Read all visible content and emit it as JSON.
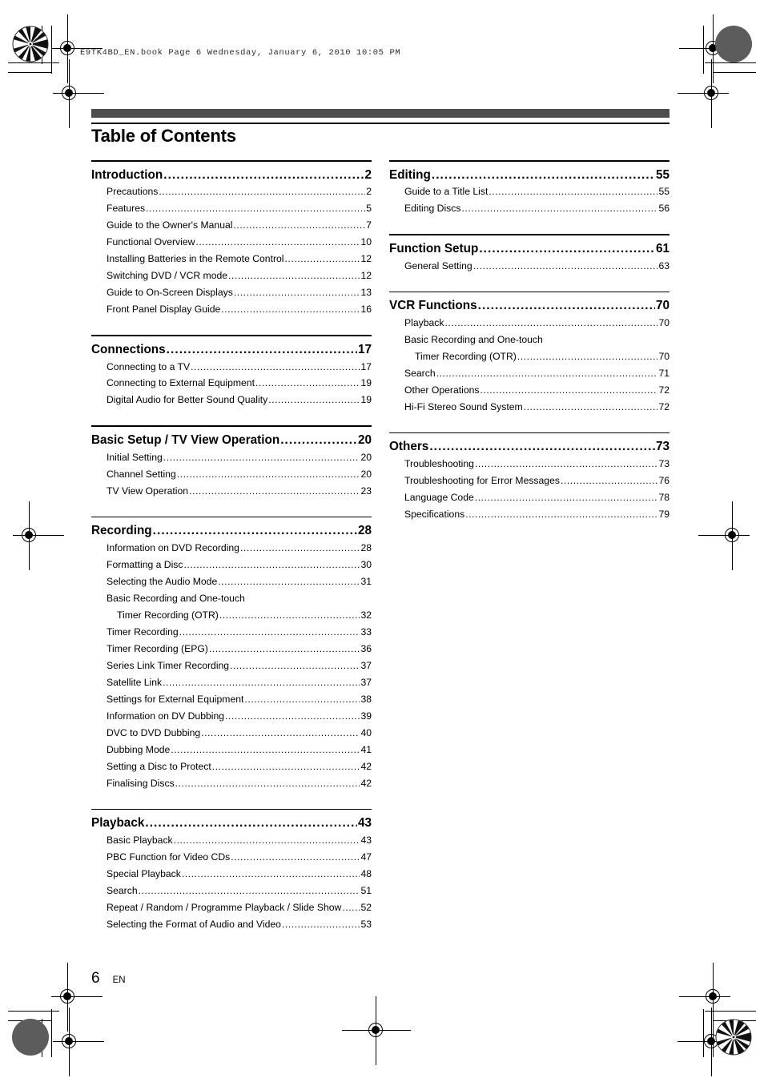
{
  "print_slug": "E9TK4BD_EN.book  Page 6  Wednesday, January 6, 2010  10:05 PM",
  "page_title": "Table of Contents",
  "footer": {
    "page_number": "6",
    "language_code": "EN"
  },
  "leader_dots": "..................................................................................................................",
  "columns": [
    {
      "name": "left-column",
      "sections": [
        {
          "heading": "Introduction",
          "page": "2",
          "entries": [
            {
              "label": "Precautions",
              "page": "2"
            },
            {
              "label": "Features",
              "page": "5"
            },
            {
              "label": "Guide to the Owner's Manual",
              "page": "7"
            },
            {
              "label": "Functional Overview",
              "page": "10"
            },
            {
              "label": "Installing Batteries in the Remote Control",
              "page": "12"
            },
            {
              "label": "Switching DVD / VCR mode",
              "page": "12"
            },
            {
              "label": "Guide to On-Screen Displays",
              "page": "13"
            },
            {
              "label": "Front Panel Display Guide",
              "page": "16"
            }
          ]
        },
        {
          "heading": "Connections",
          "page": "17",
          "entries": [
            {
              "label": "Connecting to a TV",
              "page": "17"
            },
            {
              "label": "Connecting to External Equipment",
              "page": "19"
            },
            {
              "label": "Digital Audio for Better Sound Quality",
              "page": "19"
            }
          ]
        },
        {
          "heading": "Basic Setup / TV View Operation",
          "page": "20",
          "entries": [
            {
              "label": "Initial Setting",
              "page": "20"
            },
            {
              "label": "Channel Setting",
              "page": "20"
            },
            {
              "label": "TV View Operation",
              "page": "23"
            }
          ]
        },
        {
          "heading": "Recording",
          "page": "28",
          "entries": [
            {
              "label": "Information on DVD Recording",
              "page": "28"
            },
            {
              "label": "Formatting a Disc",
              "page": "30"
            },
            {
              "label": "Selecting the Audio Mode",
              "page": "31"
            },
            {
              "label": "Basic Recording and One-touch",
              "label2": "Timer Recording (OTR)",
              "page": "32"
            },
            {
              "label": "Timer Recording",
              "page": "33"
            },
            {
              "label": "Timer Recording (EPG)",
              "page": "36"
            },
            {
              "label": "Series Link Timer Recording",
              "page": "37"
            },
            {
              "label": "Satellite Link",
              "page": "37"
            },
            {
              "label": "Settings for External Equipment",
              "page": "38"
            },
            {
              "label": "Information on DV Dubbing",
              "page": "39"
            },
            {
              "label": "DVC to DVD Dubbing",
              "page": "40"
            },
            {
              "label": "Dubbing Mode",
              "page": "41"
            },
            {
              "label": "Setting a Disc to Protect",
              "page": "42"
            },
            {
              "label": "Finalising Discs",
              "page": "42"
            }
          ]
        },
        {
          "heading": "Playback",
          "page": "43",
          "entries": [
            {
              "label": "Basic Playback",
              "page": "43"
            },
            {
              "label": "PBC Function for Video CDs",
              "page": "47"
            },
            {
              "label": "Special Playback",
              "page": "48"
            },
            {
              "label": "Search",
              "page": "51"
            },
            {
              "label": "Repeat / Random / Programme Playback / Slide Show",
              "page": "52"
            },
            {
              "label": "Selecting the Format of Audio and Video",
              "page": "53"
            }
          ]
        }
      ]
    },
    {
      "name": "right-column",
      "sections": [
        {
          "heading": "Editing",
          "page": "55",
          "entries": [
            {
              "label": "Guide to a Title List",
              "page": "55"
            },
            {
              "label": "Editing Discs",
              "page": "56"
            }
          ]
        },
        {
          "heading": "Function Setup",
          "page": "61",
          "entries": [
            {
              "label": "General Setting",
              "page": "63"
            }
          ]
        },
        {
          "heading": "VCR Functions",
          "page": "70",
          "entries": [
            {
              "label": "Playback",
              "page": "70"
            },
            {
              "label": "Basic Recording and One-touch",
              "label2": "Timer Recording (OTR)",
              "page": "70"
            },
            {
              "label": "Search",
              "page": "71"
            },
            {
              "label": "Other Operations",
              "page": "72"
            },
            {
              "label": "Hi-Fi Stereo Sound System",
              "page": "72"
            }
          ]
        },
        {
          "heading": "Others",
          "page": "73",
          "entries": [
            {
              "label": "Troubleshooting",
              "page": "73"
            },
            {
              "label": "Troubleshooting for Error Messages",
              "page": "76"
            },
            {
              "label": "Language Code",
              "page": "78"
            },
            {
              "label": "Specifications",
              "page": "79"
            }
          ]
        }
      ]
    }
  ]
}
